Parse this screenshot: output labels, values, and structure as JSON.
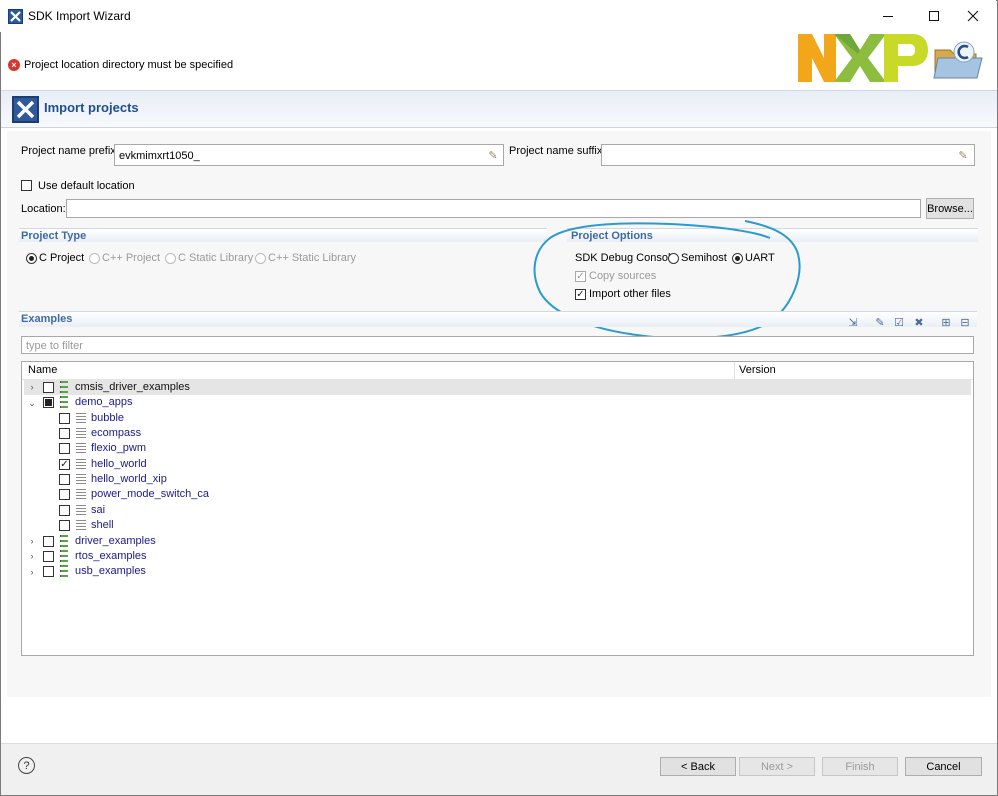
{
  "window": {
    "title": "SDK Import Wizard",
    "error_message": "Project location directory must be specified",
    "brand_logo_text": "NXP"
  },
  "banner": {
    "title": "Import projects"
  },
  "form": {
    "prefix_label": "Project name prefix:",
    "prefix_value": "evkmimxrt1050_",
    "suffix_label": "Project name suffix:",
    "suffix_value": "",
    "use_default_location_label": "Use default location",
    "use_default_location_checked": false,
    "location_label": "Location:",
    "location_value": "",
    "browse_label": "Browse..."
  },
  "project_type": {
    "heading": "Project Type",
    "options": [
      "C Project",
      "C++ Project",
      "C Static Library",
      "C++ Static Library"
    ],
    "selected": "C Project"
  },
  "project_options": {
    "heading": "Project Options",
    "debug_console_label": "SDK Debug Console",
    "debug_console_options": [
      "Semihost",
      "UART"
    ],
    "debug_console_selected": "UART",
    "copy_sources_label": "Copy sources",
    "copy_sources_checked": true,
    "copy_sources_enabled": false,
    "import_other_files_label": "Import other files",
    "import_other_files_checked": true
  },
  "examples": {
    "heading": "Examples",
    "filter_placeholder": "type to filter",
    "columns": [
      "Name",
      "Version"
    ],
    "rows": [
      {
        "label": "cmsis_driver_examples",
        "expanded": false,
        "checked": "none"
      },
      {
        "label": "demo_apps",
        "expanded": true,
        "checked": "partial"
      },
      {
        "label": "bubble",
        "checked": "none"
      },
      {
        "label": "ecompass",
        "checked": "none"
      },
      {
        "label": "flexio_pwm",
        "checked": "none"
      },
      {
        "label": "hello_world",
        "checked": "checked"
      },
      {
        "label": "hello_world_xip",
        "checked": "none"
      },
      {
        "label": "power_mode_switch_ca",
        "checked": "none"
      },
      {
        "label": "sai",
        "checked": "none"
      },
      {
        "label": "shell",
        "checked": "none"
      },
      {
        "label": "driver_examples",
        "expanded": false,
        "checked": "none"
      },
      {
        "label": "rtos_examples",
        "expanded": false,
        "checked": "none"
      },
      {
        "label": "usb_examples",
        "expanded": false,
        "checked": "none"
      }
    ]
  },
  "footer": {
    "help_label": "?",
    "back_label": "< Back",
    "next_label": "Next >",
    "finish_label": "Finish",
    "cancel_label": "Cancel"
  },
  "colors": {
    "accent": "#1e4f8f",
    "section_heading": "#3e6aa6",
    "error": "#d9372b",
    "annotation_ink": "#2a9ad0",
    "tree_text": "#1a1a8c"
  },
  "icons": [
    "sdk-wizard-icon",
    "error-icon",
    "nxp-logo",
    "folder-icon",
    "minimize-icon",
    "maximize-icon",
    "close-icon",
    "help-icon"
  ]
}
